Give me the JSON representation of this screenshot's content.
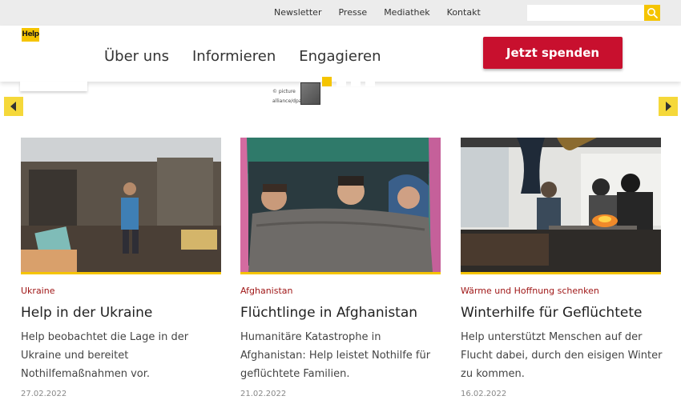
{
  "topnav": [
    "Newsletter",
    "Presse",
    "Mediathek",
    "Kontakt"
  ],
  "search": {
    "placeholder": ""
  },
  "logo": "Help",
  "mainnav": [
    "Über uns",
    "Informieren",
    "Engagieren"
  ],
  "donate_label": "Jetzt spenden",
  "slider": {
    "credit": "© picture alliance/dpa/TASS",
    "dot_count": 4,
    "active_dot": 0
  },
  "colors": {
    "accent": "#f5c400",
    "donate": "#c8102e",
    "category": "#a01818"
  },
  "icons": {
    "search": "search-icon",
    "prev": "chevron-left-icon",
    "next": "chevron-right-icon"
  },
  "cards": [
    {
      "category": "Ukraine",
      "title": "Help in der Ukraine",
      "description": "Help beobachtet die Lage in der Ukraine und bereitet Nothilfemaßnahmen vor.",
      "date": "27.02.2022"
    },
    {
      "category": "Afghanistan",
      "title": "Flüchtlinge in Afghanistan",
      "description": "Humanitäre Katastrophe in Afghanistan: Help leistet Nothilfe für geflüchtete Familien.",
      "date": "21.02.2022"
    },
    {
      "category": "Wärme und Hoffnung schenken",
      "title": "Winterhilfe für Geflüchtete",
      "description": "Help unterstützt Menschen auf der Flucht dabei, durch den eisigen Winter zu kommen.",
      "date": "16.02.2022"
    }
  ]
}
